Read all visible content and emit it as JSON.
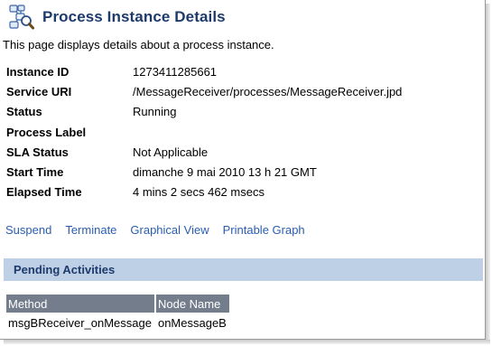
{
  "header": {
    "title": "Process Instance Details",
    "icon": "process-instance-icon"
  },
  "intro": "This page displays details about a process instance.",
  "details": [
    {
      "label": "Instance ID",
      "value": "1273411285661"
    },
    {
      "label": "Service URI",
      "value": "/MessageReceiver/processes/MessageReceiver.jpd"
    },
    {
      "label": "Status",
      "value": "Running"
    },
    {
      "label": "Process Label",
      "value": ""
    },
    {
      "label": "SLA Status",
      "value": "Not Applicable"
    },
    {
      "label": "Start Time",
      "value": "dimanche 9 mai 2010 13 h 21 GMT"
    },
    {
      "label": "Elapsed Time",
      "value": "4 mins 2 secs 462 msecs"
    }
  ],
  "actions": {
    "suspend": "Suspend",
    "terminate": "Terminate",
    "graphical_view": "Graphical View",
    "printable_graph": "Printable Graph"
  },
  "pending": {
    "title": "Pending Activities",
    "columns": [
      "Method",
      "Node Name"
    ],
    "rows": [
      [
        "msgBReceiver_onMessage",
        "onMessageB"
      ]
    ]
  },
  "colors": {
    "title": "#1e3a6b",
    "link": "#2a5db0",
    "section_bg": "#bdd0e6",
    "table_header_bg": "#737d8c"
  }
}
